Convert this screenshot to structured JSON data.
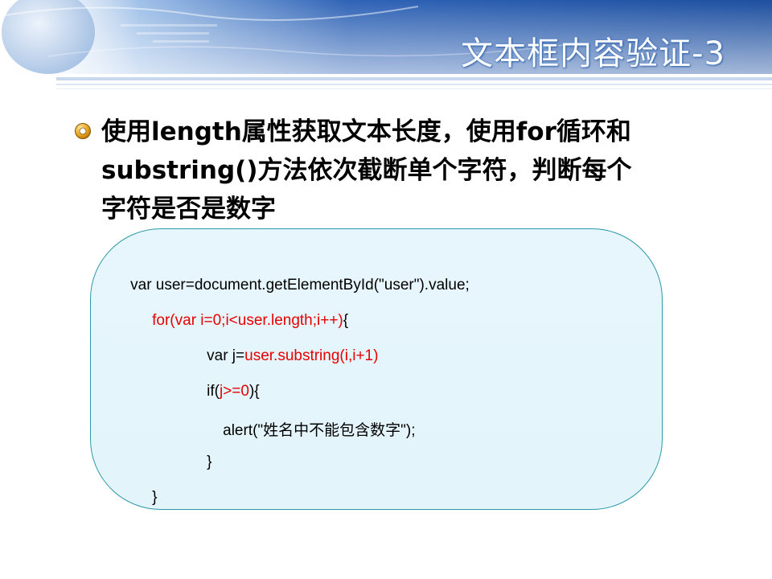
{
  "header": {
    "title": "文本框内容验证-3"
  },
  "bullet": {
    "icon": "gold-ring-bullet-icon",
    "lines": [
      "使用length属性获取文本长度，使用for循环和",
      "substring()方法依次截断单个字符，判断每个",
      "字符是否是数字"
    ]
  },
  "code": {
    "line1": "var user=document.getElementById(\"user\").value;",
    "line2": "for(var i=0;i<user.length;i++)",
    "line2_end": "{",
    "line3_a": "var j=",
    "line3_b": "user.substring(i,i+1)",
    "line4_a": "if(",
    "line4_b": "j>=0",
    "line4_c": "){",
    "line5": "alert(\"姓名中不能包含数字\");",
    "line6": "}",
    "line7": "}"
  },
  "colors": {
    "header_blue": "#2c5aa0",
    "box_border": "#2b9aa8",
    "box_fill": "#e5f5fb",
    "highlight_red": "#e60000",
    "bullet_gold": "#e8a020"
  }
}
